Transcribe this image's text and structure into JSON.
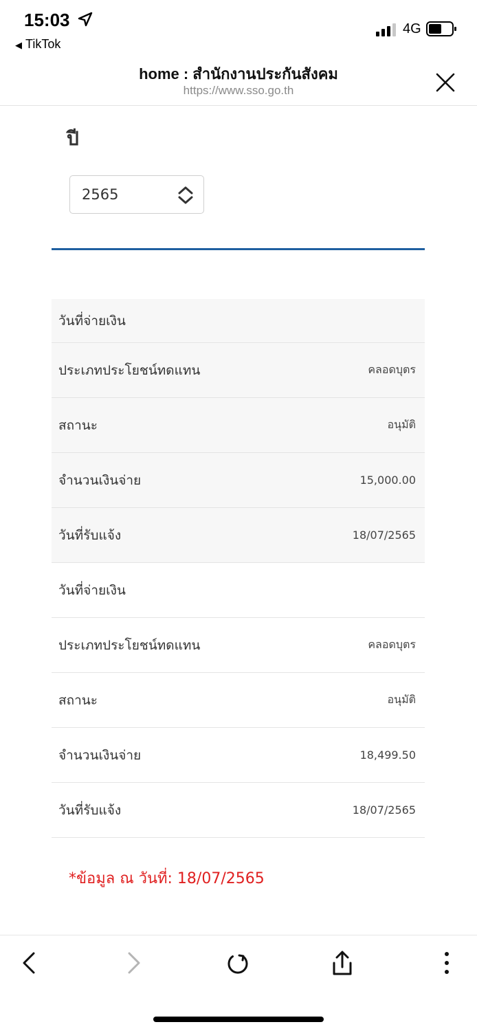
{
  "status_bar": {
    "time": "15:03",
    "back_app": "TikTok",
    "network": "4G"
  },
  "browser": {
    "title": "home : สำนักงานประกันสังคม",
    "url": "https://www.sso.go.th"
  },
  "year": {
    "label": "ปี",
    "selected": "2565"
  },
  "records": [
    {
      "rows": [
        {
          "label": "วันที่จ่ายเงิน",
          "value": ""
        },
        {
          "label": "ประเภทประโยชน์ทดแทน",
          "value": "คลอดบุตร"
        },
        {
          "label": "สถานะ",
          "value": "อนุมัติ"
        },
        {
          "label": "จำนวนเงินจ่าย",
          "value": "15,000.00"
        },
        {
          "label": "วันที่รับแจ้ง",
          "value": "18/07/2565"
        }
      ]
    },
    {
      "rows": [
        {
          "label": "วันที่จ่ายเงิน",
          "value": ""
        },
        {
          "label": "ประเภทประโยชน์ทดแทน",
          "value": "คลอดบุตร"
        },
        {
          "label": "สถานะ",
          "value": "อนุมัติ"
        },
        {
          "label": "จำนวนเงินจ่าย",
          "value": "18,499.50"
        },
        {
          "label": "วันที่รับแจ้ง",
          "value": "18/07/2565"
        }
      ]
    }
  ],
  "note": "*ข้อมูล ณ วันที่:   18/07/2565",
  "colors": {
    "accent_rule": "#1e5fa0",
    "note": "#e02020"
  },
  "toolbar": {
    "icons": [
      "back-icon",
      "forward-icon",
      "reload-icon",
      "share-icon",
      "more-icon"
    ]
  }
}
